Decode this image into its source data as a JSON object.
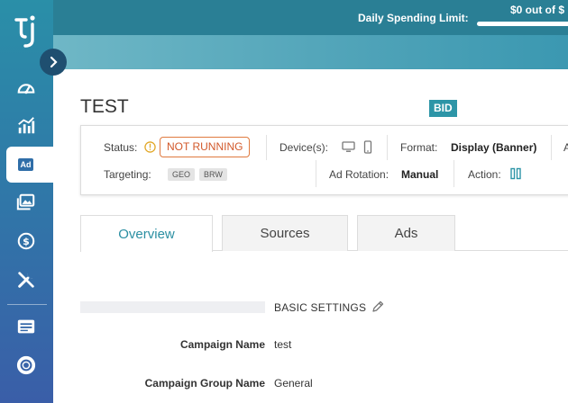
{
  "header": {
    "limit_label": "Daily Spending Limit:",
    "limit_value": "$0 out of $"
  },
  "campaign": {
    "title": "TEST",
    "bid_badge": "BID"
  },
  "info": {
    "status_label": "Status:",
    "status_value": "NOT RUNNING",
    "devices_label": "Device(s):",
    "format_label": "Format:",
    "format_value": "Display (Banner)",
    "targeting_label": "Targeting:",
    "targeting_tags": [
      "GEO",
      "BRW"
    ],
    "rotation_label": "Ad Rotation:",
    "rotation_value": "Manual",
    "action_label": "Action:"
  },
  "tabs": [
    {
      "label": "Overview",
      "active": true
    },
    {
      "label": "Sources",
      "active": false
    },
    {
      "label": "Ads",
      "active": false
    }
  ],
  "settings": {
    "section_title": "BASIC SETTINGS",
    "fields": [
      {
        "label": "Campaign Name",
        "value": "test"
      },
      {
        "label": "Campaign Group Name",
        "value": "General"
      }
    ]
  },
  "sidebar": {
    "active_label": "Ad",
    "items": [
      "dashboard-icon",
      "stats-icon",
      "ads-icon",
      "media-icon",
      "billing-icon",
      "tools-icon",
      "list-icon",
      "support-icon"
    ]
  },
  "colors": {
    "accent": "#2d95a7",
    "status": "#d2582a",
    "sidebar_top": "#2a8fa8",
    "sidebar_bottom": "#3a5ea8"
  }
}
